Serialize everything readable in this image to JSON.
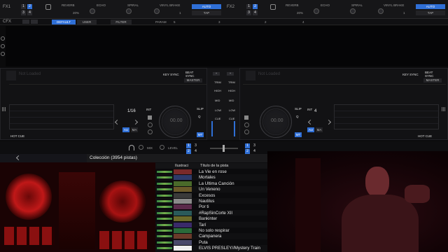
{
  "fx": [
    {
      "label": "FX1",
      "slots": [
        "1",
        "2",
        "3",
        "4"
      ],
      "slot_active": [
        false,
        true,
        false,
        false
      ],
      "effects": [
        "REVERB",
        "ECHO",
        "SPIRAL",
        "VINYL BRAKE"
      ],
      "percent": "20%",
      "beats": "1",
      "mode_a": "AUTO",
      "mode_b": "TAP"
    },
    {
      "label": "FX2",
      "slots": [
        "1",
        "2",
        "3",
        "4"
      ],
      "slot_active": [
        false,
        true,
        false,
        false
      ],
      "effects": [
        "REVERB",
        "ECHO",
        "SPIRAL",
        "VINYL BRAKE"
      ],
      "percent": "20%",
      "beats": "1",
      "mode_a": "AUTO",
      "mode_b": "TAP"
    }
  ],
  "cfx": {
    "label": "CFX",
    "default": "DEFAULT",
    "user": "USER",
    "filter": "FILTER",
    "param": "PARAM",
    "values": [
      "5",
      "3",
      "2",
      "4"
    ]
  },
  "decks": [
    {
      "title": "Not Loaded",
      "key_sync": "KEY SYNC",
      "beat_sync": "BEAT SYNC",
      "master": "MASTER",
      "loop": "1/16",
      "int": "INT",
      "slip": "SLIP",
      "q": "Q",
      "au": "AU",
      "ma": "MA",
      "time": "00.00",
      "hot_cue": "HOT CUE",
      "mt": "MT"
    },
    {
      "title": "Not Loaded",
      "key_sync": "KEY SYNC",
      "beat_sync": "BEAT SYNC",
      "master": "MASTER",
      "loop": "4",
      "int": "INT",
      "slip": "SLIP",
      "q": "Q",
      "au": "AU",
      "ma": "MA",
      "time": "00.00",
      "hot_cue": "HOT CUE",
      "mt": "MT"
    }
  ],
  "mixer": {
    "trim": "TRIM",
    "high": "HIGH",
    "mid": "MID",
    "low": "LOW",
    "cue": "CUE",
    "mix": "MIX",
    "level": "LEVEL",
    "ch": [
      "1",
      "2",
      "3",
      "4"
    ]
  },
  "library": {
    "collection": "Colección (3954 pistas)",
    "col_art": "Ilustraci",
    "col_title": "Título de la pista",
    "tracks": [
      "La Vie en rose",
      "Mortales",
      "La Ultima Canción",
      "Un Veneno",
      "Excesos",
      "Nautilus",
      "Por ti",
      "#RapSinCorte XII",
      "Bankinter",
      "Tarí",
      "No solo respirar",
      "Campanera",
      "Puta",
      "ELVIS PRESLEY//Mystery Train"
    ]
  },
  "colors": {
    "accent": "#2f6fd6",
    "red_glow": "#c01818",
    "wave_green": "#6cc24a"
  }
}
